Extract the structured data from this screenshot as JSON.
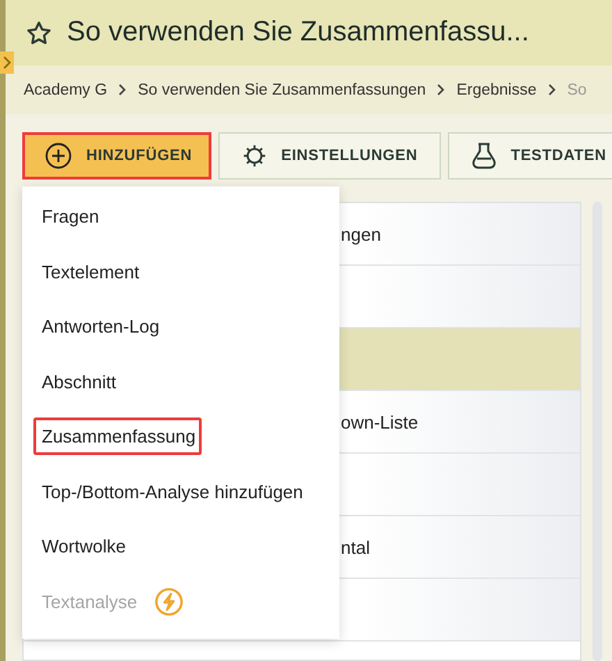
{
  "header": {
    "title": "So verwenden Sie Zusammenfassu...",
    "favorite": false
  },
  "breadcrumb": [
    "Academy G",
    "So verwenden Sie Zusammenfassungen",
    "Ergebnisse",
    "So"
  ],
  "toolbar": [
    {
      "label": "HINZUFÜGEN",
      "kind": "add",
      "highlighted": true
    },
    {
      "label": "EINSTELLUNGEN",
      "kind": "settings",
      "highlighted": false
    },
    {
      "label": "TESTDATEN",
      "kind": "testdata",
      "highlighted": false
    }
  ],
  "menu": [
    {
      "label": "Fragen",
      "highlighted": false,
      "disabled": false
    },
    {
      "label": "Textelement",
      "highlighted": false,
      "disabled": false
    },
    {
      "label": "Antworten-Log",
      "highlighted": false,
      "disabled": false
    },
    {
      "label": "Abschnitt",
      "highlighted": false,
      "disabled": false
    },
    {
      "label": "Zusammenfassung",
      "highlighted": true,
      "disabled": false
    },
    {
      "label": "Top-/Bottom-Analyse hinzufügen",
      "highlighted": false,
      "disabled": false
    },
    {
      "label": "Wortwolke",
      "highlighted": false,
      "disabled": false
    },
    {
      "label": "Textanalyse",
      "highlighted": false,
      "disabled": true,
      "premium": true
    }
  ],
  "rows": [
    {
      "text": "ngen",
      "selected": false
    },
    {
      "selected": false
    },
    {
      "selected": true
    },
    {
      "text": "own-Liste",
      "selected": false
    },
    {
      "selected": false
    },
    {
      "text": "ntal",
      "selected": false
    },
    {
      "selected": false
    }
  ]
}
